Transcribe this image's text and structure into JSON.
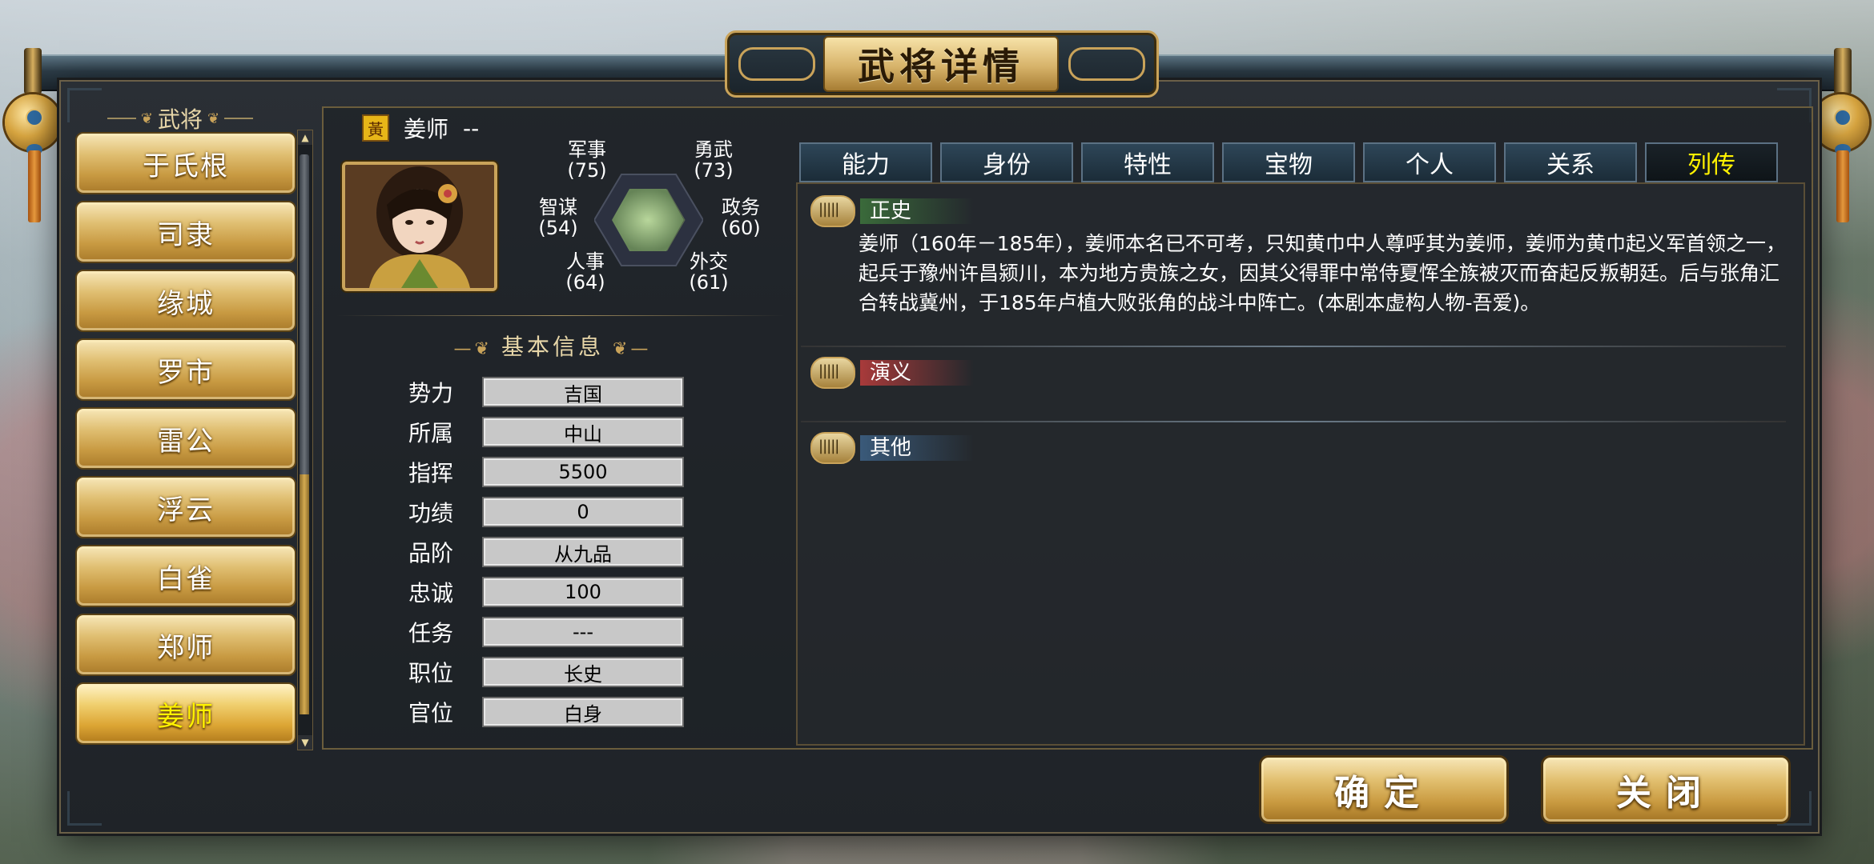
{
  "window": {
    "title": "武将详情"
  },
  "sidebar": {
    "heading": "武将",
    "generals": [
      "于氏根",
      "司隶",
      "缘城",
      "罗市",
      "雷公",
      "浮云",
      "白雀",
      "郑师",
      "姜师"
    ],
    "selected_index": 8
  },
  "general": {
    "name": "姜师",
    "dash": "--",
    "seal_char": "黃",
    "stats": {
      "military": {
        "label": "军事",
        "value": "(75)"
      },
      "valor": {
        "label": "勇武",
        "value": "(73)"
      },
      "strategy": {
        "label": "智谋",
        "value": "(54)"
      },
      "politics": {
        "label": "政务",
        "value": "(60)"
      },
      "personnel": {
        "label": "人事",
        "value": "(64)"
      },
      "diplomacy": {
        "label": "外交",
        "value": "(61)"
      }
    }
  },
  "basic_info": {
    "title": "基本信息",
    "rows": [
      {
        "label": "势力",
        "value": "吉国"
      },
      {
        "label": "所属",
        "value": "中山"
      },
      {
        "label": "指挥",
        "value": "5500"
      },
      {
        "label": "功绩",
        "value": "0"
      },
      {
        "label": "品阶",
        "value": "从九品"
      },
      {
        "label": "忠诚",
        "value": "100"
      },
      {
        "label": "任务",
        "value": "---"
      },
      {
        "label": "职位",
        "value": "长史"
      },
      {
        "label": "官位",
        "value": "白身"
      }
    ]
  },
  "tabs": [
    "能力",
    "身份",
    "特性",
    "宝物",
    "个人",
    "关系",
    "列传"
  ],
  "active_tab_index": 6,
  "biography": {
    "history_label": "正史",
    "history_text": "姜师（160年－185年），姜师本名已不可考，只知黄巾中人尊呼其为姜师，姜师为黄巾起义军首领之一，起兵于豫州许昌颍川，本为地方贵族之女，因其父得罪中常侍夏恽全族被灭而奋起反叛朝廷。后与张角汇合转战冀州，于185年卢植大败张角的战斗中阵亡。(本剧本虚构人物-吾爱)。",
    "romance_label": "演义",
    "other_label": "其他"
  },
  "buttons": {
    "confirm": "确定",
    "close": "关闭"
  },
  "colors": {
    "selected_text": "#fff200",
    "gold": "#c9a35a",
    "panel": "#1f2328"
  }
}
